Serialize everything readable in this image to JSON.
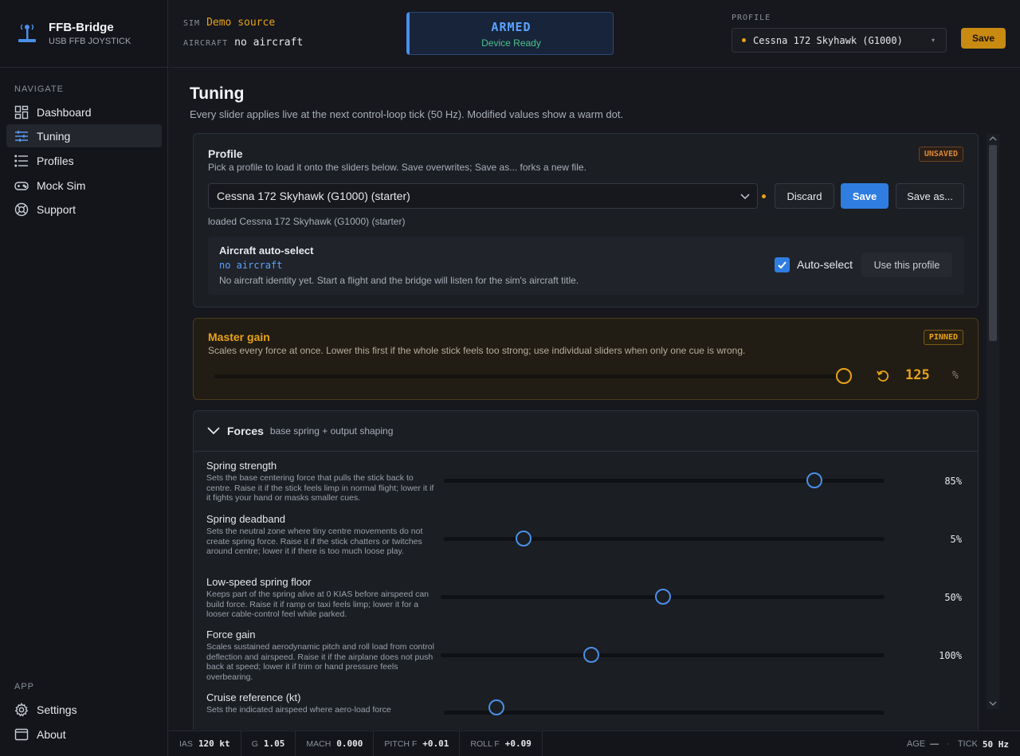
{
  "app": {
    "name": "FFB-Bridge",
    "subtitle": "USB FFB JOYSTICK"
  },
  "sidebar": {
    "navigate_heading": "NAVIGATE",
    "app_heading": "APP",
    "items": [
      {
        "label": "Dashboard",
        "icon": "dashboard-icon",
        "active": false
      },
      {
        "label": "Tuning",
        "icon": "sliders-icon",
        "active": true
      },
      {
        "label": "Profiles",
        "icon": "list-icon",
        "active": false
      },
      {
        "label": "Mock Sim",
        "icon": "gamepad-icon",
        "active": false
      },
      {
        "label": "Support",
        "icon": "lifebuoy-icon",
        "active": false
      }
    ],
    "app_items": [
      {
        "label": "Settings",
        "icon": "gear-icon"
      },
      {
        "label": "About",
        "icon": "window-icon"
      }
    ]
  },
  "topbar": {
    "sim_label": "SIM",
    "sim_value": "Demo source",
    "aircraft_label": "AIRCRAFT",
    "aircraft_value": "no aircraft",
    "armed_title": "ARMED",
    "armed_sub": "Device Ready",
    "profile_label": "PROFILE",
    "profile_value": "Cessna 172 Skyhawk (G1000)",
    "save_label": "Save"
  },
  "page": {
    "title": "Tuning",
    "subtitle": "Every slider applies live at the next control-loop tick (50 Hz). Modified values show a warm dot."
  },
  "profile_card": {
    "title": "Profile",
    "badge": "UNSAVED",
    "desc": "Pick a profile to load it onto the sliders below. Save overwrites; Save as... forks a new file.",
    "select_value": "Cessna 172 Skyhawk (G1000) (starter)",
    "discard_label": "Discard",
    "save_label": "Save",
    "save_as_label": "Save as...",
    "loaded_text": "loaded Cessna 172 Skyhawk (G1000) (starter)",
    "autoselect": {
      "title": "Aircraft auto-select",
      "aircraft": "no aircraft",
      "desc": "No aircraft identity yet. Start a flight and the bridge will listen for the sim's aircraft title.",
      "checkbox_label": "Auto-select",
      "checked": true,
      "use_profile_label": "Use this profile"
    }
  },
  "master_gain": {
    "title": "Master gain",
    "badge": "PINNED",
    "desc": "Scales every force at once. Lower this first if the whole stick feels too strong; use individual sliders when only one cue is wrong.",
    "value": "125",
    "unit": "%",
    "fraction": 1.0
  },
  "forces": {
    "title": "Forces",
    "subtitle": "base spring + output shaping",
    "rows": [
      {
        "title": "Spring strength",
        "desc": "Sets the base centering force that pulls the stick back to centre. Raise it if the stick feels limp in normal flight; lower it if it fights your hand or masks smaller cues.",
        "value": "85%",
        "fraction": 0.84
      },
      {
        "title": "Spring deadband",
        "desc": "Sets the neutral zone where tiny centre movements do not create spring force. Raise it if the stick chatters or twitches around centre; lower it if there is too much loose play.",
        "value": "5%",
        "fraction": 0.18
      },
      {
        "title": "Low-speed spring floor",
        "desc": "Keeps part of the spring alive at 0 KIAS before airspeed can build force. Raise it if ramp or taxi feels limp; lower it for a looser cable-control feel while parked.",
        "value": "50%",
        "fraction": 0.5
      },
      {
        "title": "Force gain",
        "desc": "Scales sustained aerodynamic pitch and roll load from control deflection and airspeed. Raise it if the airplane does not push back at speed; lower it if trim or hand pressure feels overbearing.",
        "value": "100%",
        "fraction": 0.34
      },
      {
        "title": "Cruise reference (kt)",
        "desc": "Sets the indicated airspeed where aero-load force",
        "value": "",
        "fraction": 0.12
      }
    ]
  },
  "statusbar": {
    "items": [
      {
        "label": "IAS",
        "value": "120 kt"
      },
      {
        "label": "G",
        "value": "1.05"
      },
      {
        "label": "MACH",
        "value": "0.000"
      },
      {
        "label": "PITCH F",
        "value": "+0.01"
      },
      {
        "label": "ROLL F",
        "value": "+0.09"
      }
    ],
    "age_label": "AGE",
    "age_value": "—",
    "tick_label": "TICK",
    "tick_value": "50 Hz"
  },
  "colors": {
    "accent": "#4a8fe8",
    "warm": "#e8a317",
    "ok": "#4cc38a",
    "save_blue": "#2f7de1"
  }
}
